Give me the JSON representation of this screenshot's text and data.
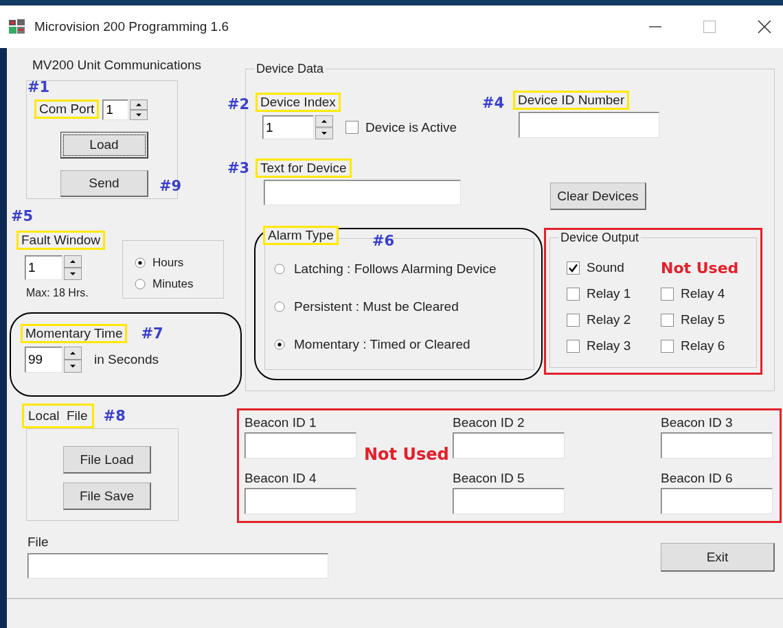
{
  "window": {
    "title": "Microvision 200 Programming 1.6"
  },
  "communications": {
    "heading": "MV200 Unit Communications",
    "marker": "#1",
    "com_port": {
      "label": "Com Port",
      "highlighted": true,
      "value": "1"
    },
    "buttons": [
      {
        "label": "Load",
        "focused": true
      },
      {
        "label": "Send",
        "focused": false
      }
    ],
    "send_marker": "#9"
  },
  "fault_window": {
    "marker": "#5",
    "label": "Fault Window",
    "highlighted": true,
    "value": "1",
    "note": "Max: 18 Hrs.",
    "units": [
      {
        "label": "Hours",
        "selected": true
      },
      {
        "label": "Minutes",
        "selected": false
      }
    ]
  },
  "momentary_time": {
    "label": "Momentary Time",
    "highlighted": true,
    "marker": "#7",
    "value": "99",
    "units": "in Seconds",
    "circled": true
  },
  "device_data": {
    "title": "Device Data",
    "device_index": {
      "marker": "#2",
      "label": "Device Index",
      "highlighted": true,
      "value": "1"
    },
    "device_active": {
      "label": "Device is Active",
      "checked": false
    },
    "device_id": {
      "marker": "#4",
      "label": "Device ID Number",
      "highlighted": true
    },
    "device_text": {
      "marker": "#3",
      "label": "Text for Device",
      "highlighted": true
    },
    "clear_button": "Clear Devices",
    "alarm_type": {
      "label": "Alarm Type",
      "highlighted": true,
      "marker": "#6",
      "circled": true,
      "options": [
        {
          "label": "Latching : Follows Alarming Device",
          "selected": false
        },
        {
          "label": "Persistent : Must be Cleared",
          "selected": false
        },
        {
          "label": "Momentary : Timed or Cleared",
          "selected": true
        }
      ]
    },
    "device_output": {
      "title": "Device Output",
      "flagged": true,
      "note": "Not Used",
      "outputs": [
        {
          "label": "Sound",
          "checked": true
        },
        {
          "label": "Relay 1",
          "checked": false
        },
        {
          "label": "Relay 2",
          "checked": false
        },
        {
          "label": "Relay 3",
          "checked": false
        },
        {
          "label": "Relay 4",
          "checked": false
        },
        {
          "label": "Relay 5",
          "checked": false
        },
        {
          "label": "Relay 6",
          "checked": false
        }
      ]
    }
  },
  "local_file": {
    "label": "Local  File",
    "highlighted": true,
    "marker": "#8",
    "buttons": [
      "File Load",
      "File Save"
    ]
  },
  "beacons": {
    "flagged": true,
    "note": "Not Used",
    "fields": [
      {
        "label": "Beacon ID 1"
      },
      {
        "label": "Beacon ID 2"
      },
      {
        "label": "Beacon ID 3"
      },
      {
        "label": "Beacon ID 4"
      },
      {
        "label": "Beacon ID 5"
      },
      {
        "label": "Beacon ID 6"
      }
    ]
  },
  "file": {
    "label": "File"
  },
  "exit_button": "Exit"
}
